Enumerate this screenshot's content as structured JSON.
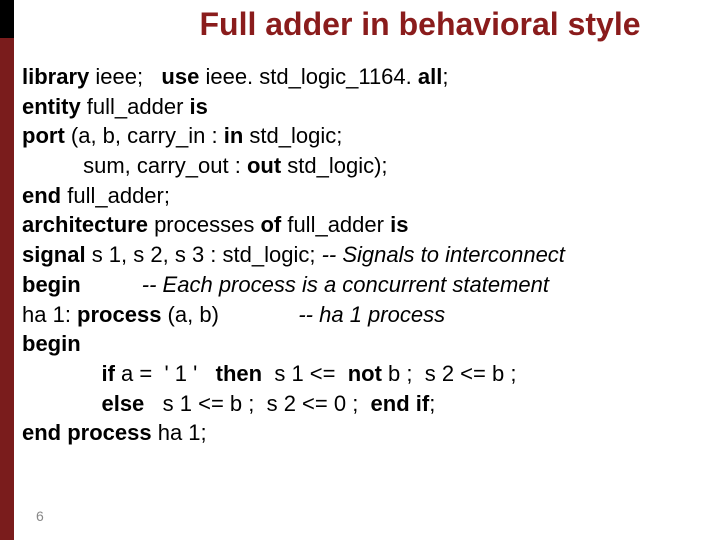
{
  "title": "Full adder in behavioral style",
  "code": {
    "l1_kw1": "library",
    "l1_t1": " ieee;   ",
    "l1_kw2": "use",
    "l1_t2": " ieee. std_logic_1164. ",
    "l1_kw3": "all",
    "l1_t3": ";",
    "l2_kw1": "entity",
    "l2_t1": " full_adder ",
    "l2_kw2": "is",
    "l3_kw1": "port",
    "l3_t1": " (a, b, carry_in : ",
    "l3_kw2": "in",
    "l3_t2": " std_logic;",
    "l4_t1": "          sum, carry_out : ",
    "l4_kw1": "out",
    "l4_t2": " std_logic);",
    "l5_kw1": "end",
    "l5_t1": " full_adder;",
    "l6_kw1": "architecture",
    "l6_t1": " processes ",
    "l6_kw2": "of",
    "l6_t2": " full_adder ",
    "l6_kw3": "is",
    "l7_kw1": "signal",
    "l7_t1": " s 1, s 2, s 3 : std_logic; ",
    "l7_c1": "-- Signals to interconnect",
    "l8_kw1": "begin",
    "l8_sp": "          ",
    "l8_c1": "-- Each process is a concurrent statement",
    "l9_t1": "ha 1: ",
    "l9_kw1": "process",
    "l9_t2": " (a, b)             ",
    "l9_c1": "-- ha 1 process",
    "l10_kw1": "begin",
    "l11_t1": "             ",
    "l11_kw1": "if",
    "l11_t2": " a =  ' 1 '   ",
    "l11_kw2": "then",
    "l11_t3": "  s 1 <=  ",
    "l11_kw3": "not",
    "l11_t4": " b ;  s 2 <= b ;",
    "l12_t1": "             ",
    "l12_kw1": "else",
    "l12_t2": "   s 1 <= b ;  s 2 <= 0 ;  ",
    "l12_kw2": "end if",
    "l12_t3": ";",
    "l13_kw1": "end process",
    "l13_t1": " ha 1;"
  },
  "page_number": "6"
}
